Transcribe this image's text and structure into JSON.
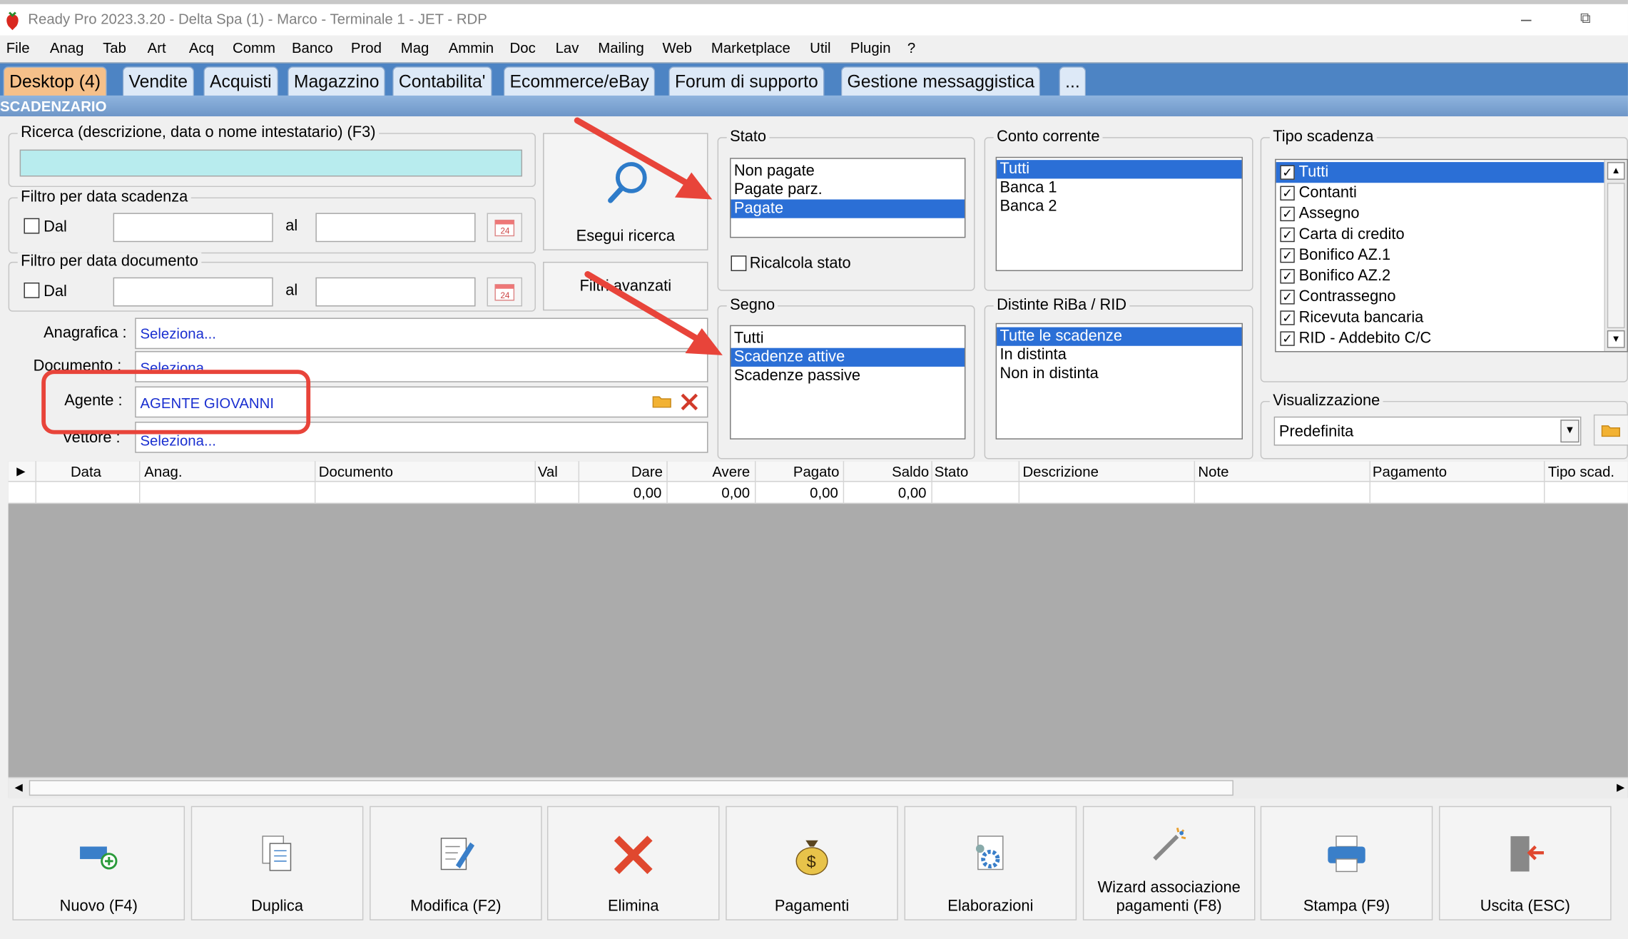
{
  "window": {
    "title": "Ready Pro 2023.3.20 - Delta Spa (1) - Marco - Terminale 1 - JET - RDP"
  },
  "menu": [
    "File",
    "Anag",
    "Tab",
    "Art",
    "Acq",
    "Comm",
    "Banco",
    "Prod",
    "Mag",
    "Ammin",
    "Doc",
    "Lav",
    "Mailing",
    "Web",
    "Marketplace",
    "Util",
    "Plugin",
    "?"
  ],
  "tabs": [
    "Desktop (4)",
    "Vendite",
    "Acquisti",
    "Magazzino",
    "Contabilita'",
    "Ecommerce/eBay",
    "Forum di supporto",
    "Gestione messaggistica",
    "..."
  ],
  "section_title": "SCADENZARIO",
  "search": {
    "label": "Ricerca (descrizione, data o nome intestatario) (F3)",
    "value": ""
  },
  "filter_scadenza": {
    "label": "Filtro per data scadenza",
    "dal": "Dal",
    "al": "al"
  },
  "filter_documento": {
    "label": "Filtro per data documento",
    "dal": "Dal",
    "al": "al"
  },
  "buttons": {
    "esegui": "Esegui ricerca",
    "filtri": "Filtri avanzati"
  },
  "fields": {
    "anagrafica": {
      "label": "Anagrafica :",
      "value": "Seleziona..."
    },
    "documento": {
      "label": "Documento :",
      "value": "Seleziona..."
    },
    "agente": {
      "label": "Agente :",
      "value": "AGENTE GIOVANNI"
    },
    "vettore": {
      "label": "Vettore :",
      "value": "Seleziona..."
    }
  },
  "stato": {
    "label": "Stato",
    "items": [
      "Non pagate",
      "Pagate parz.",
      "Pagate"
    ],
    "selected": 2,
    "ricalcola": "Ricalcola stato"
  },
  "segno": {
    "label": "Segno",
    "items": [
      "Tutti",
      "Scadenze attive",
      "Scadenze passive"
    ],
    "selected": 1
  },
  "conto": {
    "label": "Conto corrente",
    "items": [
      "Tutti",
      "Banca 1",
      "Banca 2"
    ],
    "selected": 0
  },
  "distinte": {
    "label": "Distinte RiBa / RID",
    "items": [
      "Tutte le scadenze",
      "In distinta",
      "Non in distinta"
    ],
    "selected": 0
  },
  "tipo": {
    "label": "Tipo scadenza",
    "items": [
      "Tutti",
      "Contanti",
      "Assegno",
      "Carta di credito",
      "Bonifico AZ.1",
      "Bonifico AZ.2",
      "Contrassegno",
      "Ricevuta bancaria",
      "RID - Addebito C/C"
    ],
    "selected": 0
  },
  "visualizzazione": {
    "label": "Visualizzazione",
    "value": "Predefinita"
  },
  "grid": {
    "columns": [
      "Data",
      "Anag.",
      "Documento",
      "Val",
      "Dare",
      "Avere",
      "Pagato",
      "Saldo",
      "Stato",
      "Descrizione",
      "Note",
      "Pagamento",
      "Tipo scad."
    ],
    "totals": {
      "dare": "0,00",
      "avere": "0,00",
      "pagato": "0,00",
      "saldo": "0,00"
    }
  },
  "bottom": [
    "Nuovo (F4)",
    "Duplica",
    "Modifica (F2)",
    "Elimina",
    "Pagamenti",
    "Elaborazioni",
    "Wizard associazione\npagamenti (F8)",
    "Stampa (F9)",
    "Uscita (ESC)"
  ],
  "colors": {
    "accent": "#2b6fd6",
    "tab_bar": "#4d84c4",
    "active_tab": "#f5c08a",
    "highlight": "#e8443a",
    "search_bg": "#b8ecee"
  }
}
